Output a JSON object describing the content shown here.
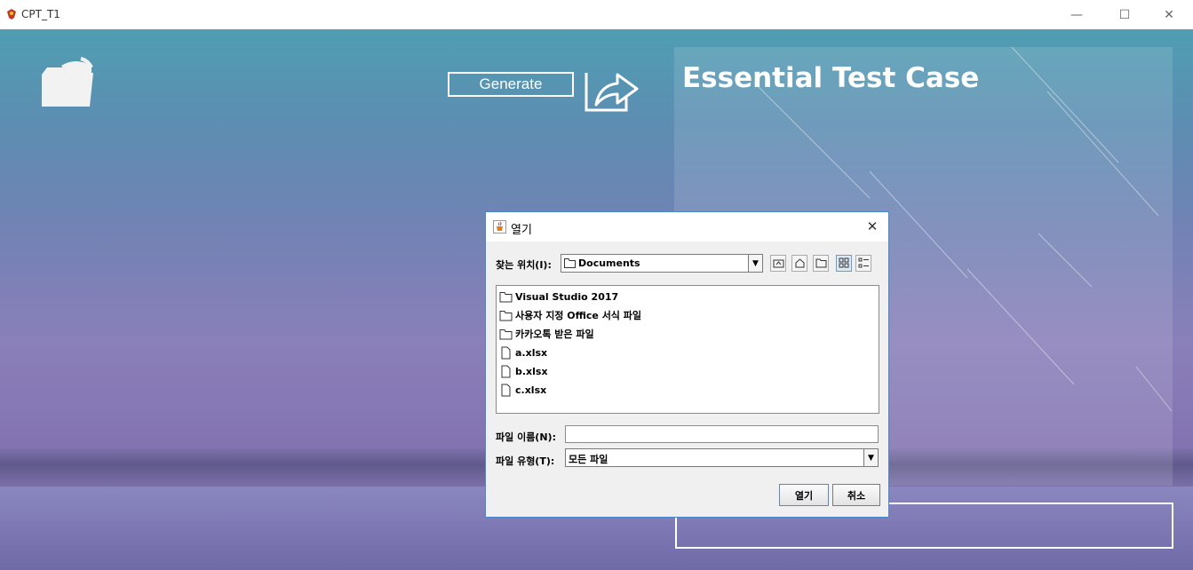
{
  "window": {
    "title": "CPT_T1",
    "controls": {
      "minimize": "—",
      "maximize": "☐",
      "close": "✕"
    }
  },
  "main": {
    "generate_label": "Generate",
    "panel_title": "Essential Test Case"
  },
  "dialog": {
    "title": "열기",
    "close_glyph": "✕",
    "lookin_label": "찾는 위치(I):",
    "lookin_value": "Documents",
    "toolbar": [
      "up-folder",
      "home",
      "new-folder",
      "list-view",
      "details-view"
    ],
    "files": [
      {
        "name": "Visual Studio 2017",
        "type": "folder"
      },
      {
        "name": "사용자 지정 Office 서식 파일",
        "type": "folder"
      },
      {
        "name": "카카오톡 받은 파일",
        "type": "folder"
      },
      {
        "name": "a.xlsx",
        "type": "file"
      },
      {
        "name": "b.xlsx",
        "type": "file"
      },
      {
        "name": "c.xlsx",
        "type": "file"
      }
    ],
    "filename_label": "파일 이름(N):",
    "filename_value": "",
    "filetype_label": "파일 유형(T):",
    "filetype_value": "모든 파일",
    "open_label": "열기",
    "cancel_label": "취소"
  },
  "colors": {
    "dialog_border": "#4a87c6",
    "accent_white": "#ffffff"
  }
}
